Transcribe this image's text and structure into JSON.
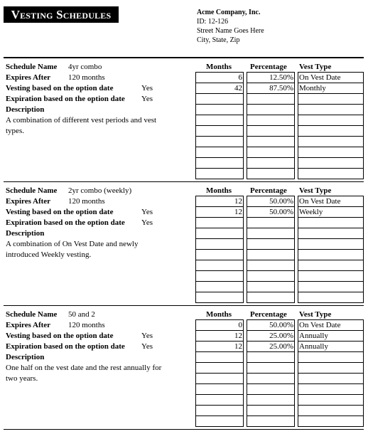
{
  "header": {
    "title": "Vesting Schedules",
    "company": {
      "name": "Acme Company, Inc.",
      "id": "ID: 12-126",
      "street": "Street Name Goes Here",
      "city": "City, State, Zip"
    }
  },
  "labels": {
    "schedule_name": "Schedule Name",
    "expires_after": "Expires After",
    "vesting_based": "Vesting based on the option date",
    "expiration_based": "Expiration based on the option date",
    "description": "Description",
    "col_months": "Months",
    "col_percentage": "Percentage",
    "col_vest_type": "Vest Type"
  },
  "schedules": [
    {
      "name": "4yr combo",
      "expires_after": "120 months",
      "vesting_based": "Yes",
      "expiration_based": "Yes",
      "description": "A combination of different vest periods and vest types.",
      "rows": [
        {
          "months": "6",
          "percentage": "12.50%",
          "vest_type": "On Vest Date"
        },
        {
          "months": "42",
          "percentage": "87.50%",
          "vest_type": "Monthly"
        },
        {
          "months": "",
          "percentage": "",
          "vest_type": ""
        },
        {
          "months": "",
          "percentage": "",
          "vest_type": ""
        },
        {
          "months": "",
          "percentage": "",
          "vest_type": ""
        },
        {
          "months": "",
          "percentage": "",
          "vest_type": ""
        },
        {
          "months": "",
          "percentage": "",
          "vest_type": ""
        },
        {
          "months": "",
          "percentage": "",
          "vest_type": ""
        },
        {
          "months": "",
          "percentage": "",
          "vest_type": ""
        },
        {
          "months": "",
          "percentage": "",
          "vest_type": ""
        }
      ]
    },
    {
      "name": "2yr combo (weekly)",
      "expires_after": "120 months",
      "vesting_based": "Yes",
      "expiration_based": "Yes",
      "description": "A combination of On Vest Date and newly introduced Weekly vesting.",
      "rows": [
        {
          "months": "12",
          "percentage": "50.00%",
          "vest_type": "On Vest Date"
        },
        {
          "months": "12",
          "percentage": "50.00%",
          "vest_type": "Weekly"
        },
        {
          "months": "",
          "percentage": "",
          "vest_type": ""
        },
        {
          "months": "",
          "percentage": "",
          "vest_type": ""
        },
        {
          "months": "",
          "percentage": "",
          "vest_type": ""
        },
        {
          "months": "",
          "percentage": "",
          "vest_type": ""
        },
        {
          "months": "",
          "percentage": "",
          "vest_type": ""
        },
        {
          "months": "",
          "percentage": "",
          "vest_type": ""
        },
        {
          "months": "",
          "percentage": "",
          "vest_type": ""
        },
        {
          "months": "",
          "percentage": "",
          "vest_type": ""
        }
      ]
    },
    {
      "name": "50 and 2",
      "expires_after": "120 months",
      "vesting_based": "Yes",
      "expiration_based": "Yes",
      "description": "One half on the vest date and the rest annually for two years.",
      "rows": [
        {
          "months": "0",
          "percentage": "50.00%",
          "vest_type": "On Vest Date"
        },
        {
          "months": "12",
          "percentage": "25.00%",
          "vest_type": "Annually"
        },
        {
          "months": "12",
          "percentage": "25.00%",
          "vest_type": "Annually"
        },
        {
          "months": "",
          "percentage": "",
          "vest_type": ""
        },
        {
          "months": "",
          "percentage": "",
          "vest_type": ""
        },
        {
          "months": "",
          "percentage": "",
          "vest_type": ""
        },
        {
          "months": "",
          "percentage": "",
          "vest_type": ""
        },
        {
          "months": "",
          "percentage": "",
          "vest_type": ""
        },
        {
          "months": "",
          "percentage": "",
          "vest_type": ""
        },
        {
          "months": "",
          "percentage": "",
          "vest_type": ""
        }
      ]
    }
  ]
}
